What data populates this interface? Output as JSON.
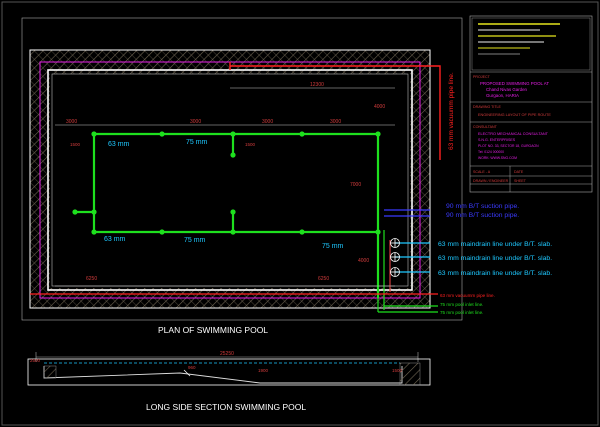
{
  "drawing": {
    "plan_title": "PLAN OF SWIMMING POOL",
    "section_title": "LONG SIDE SECTION SWIMMING POOL"
  },
  "pipe_labels": {
    "vacuum_vertical": "63 mm vacuumm pipe line.",
    "bt_suction_1": "90 mm B/T suction pipe.",
    "bt_suction_2": "90 mm B/T suction pipe.",
    "maindrain_1": "63 mm maindrain line under B/T. slab.",
    "maindrain_2": "63 mm maindrain line under B/T. slab.",
    "maindrain_3": "63 mm maindrain line under B/T. slab.",
    "vacuum_bottom": "63 mm vacuumm pipe line.",
    "inlet_1": "75 mm pool inlet line.",
    "inlet_2": "75 mm pool inlet line."
  },
  "pipe_size_labels": {
    "top_left": "63 mm",
    "top_mid": "75 mm",
    "bottom_left": "63 mm",
    "bottom_mid": "75 mm",
    "right_lower": "75 mm"
  },
  "dimensions": {
    "top_overall": "12300",
    "top_seg_1": "3000",
    "top_seg_2": "3000",
    "top_seg_3": "3000",
    "top_seg_4": "3000",
    "right_upper": "4000",
    "right_mid": "7000",
    "right_lower": "4000",
    "left_stub": "1500",
    "mid_stub": "1500",
    "bottom_left": "6250",
    "bottom_right": "6250",
    "section_overall": "25250",
    "section_left": "2500",
    "section_mid_1": "960",
    "section_mid_2": "1900",
    "section_right": "1500"
  },
  "title_block": {
    "project_label": "PROJECT",
    "project_lines": [
      "PROPOSED SWIMMING POOL AT",
      "Chand Nivas Garden",
      "Gurgaon, HARIA"
    ],
    "drawing_label": "DRAWING TITLE",
    "drawing_line": "ENGINEERING LAYOUT OF PIPE ROUTE",
    "consultant_label": "CONSULTANT",
    "consultant_lines": [
      "ELECTRO MECHANICAL CONSULTANT",
      "S.N.G. ENTERPRISES",
      "PLOT NO. 33, SECTOR 18, GURGAON",
      "Tel: 0124 000000",
      "WORK: WWW.SNG.COM"
    ],
    "scale_label": "SCALE - A",
    "date_label": "DATE",
    "drawn_label": "DRAWN / ENGINEER",
    "sheet_label": "SHEET"
  },
  "colors": {
    "background": "#000000",
    "hatch": "#8a7d6a",
    "wall": "#ffffff",
    "magenta": "#e81ee8",
    "green": "#1ee01e",
    "red": "#ff2020",
    "cyan": "#1ec8ff",
    "blue": "#3b3bff",
    "yellow": "#e6e61e",
    "dim_red": "#d23c3c"
  }
}
